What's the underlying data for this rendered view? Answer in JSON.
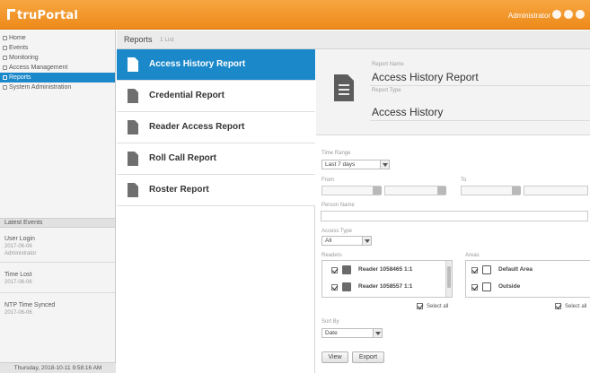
{
  "header": {
    "logo": "truPortal",
    "user": "Administrator",
    "icons": [
      "user-icon",
      "help-icon",
      "settings-icon"
    ]
  },
  "sidebar": {
    "items": [
      {
        "label": "Home",
        "icon": "home-icon"
      },
      {
        "label": "Events",
        "icon": "events-icon"
      },
      {
        "label": "Monitoring",
        "icon": "monitoring-icon"
      },
      {
        "label": "Access Management",
        "icon": "access-icon"
      },
      {
        "label": "Reports",
        "icon": "reports-icon",
        "active": true
      },
      {
        "label": "System Administration",
        "icon": "system-icon"
      }
    ],
    "latest_events_title": "Latest Events",
    "events": [
      {
        "title": "User Login",
        "time": "2017-06-06",
        "detail": "Administrator"
      },
      {
        "title": "Time Lost",
        "time": "2017-06-06"
      },
      {
        "title": "NTP Time Synced",
        "time": "2017-06-06"
      }
    ],
    "timestamp": "Thursday, 2018-10-11 9:58:16 AM"
  },
  "reports_bar": {
    "title": "Reports",
    "subtitle": "1 List"
  },
  "reports": [
    {
      "label": "Access History Report",
      "active": true
    },
    {
      "label": "Credential Report"
    },
    {
      "label": "Reader Access Report"
    },
    {
      "label": "Roll Call Report"
    },
    {
      "label": "Roster Report"
    }
  ],
  "detail": {
    "report_name_label": "Report Name",
    "report_name": "Access History Report",
    "report_type_label": "Report Type",
    "report_type": "Access History",
    "time_range_label": "Time Range",
    "time_range_value": "Last 7 days",
    "from_label": "From",
    "to_label": "To",
    "person_name_label": "Person Name",
    "access_type_label": "Access Type",
    "access_type_value": "All",
    "readers_label": "Readers",
    "readers": [
      {
        "label": "Reader 1058465 1:1",
        "checked": true
      },
      {
        "label": "Reader 1058557 1:1",
        "checked": true
      }
    ],
    "areas_label": "Areas",
    "areas": [
      {
        "label": "Default Area",
        "checked": true
      },
      {
        "label": "Outside",
        "checked": true
      }
    ],
    "select_all_label": "Select all",
    "sort_by_label": "Sort By",
    "sort_by_value": "Date",
    "view_button": "View",
    "export_button": "Export"
  }
}
